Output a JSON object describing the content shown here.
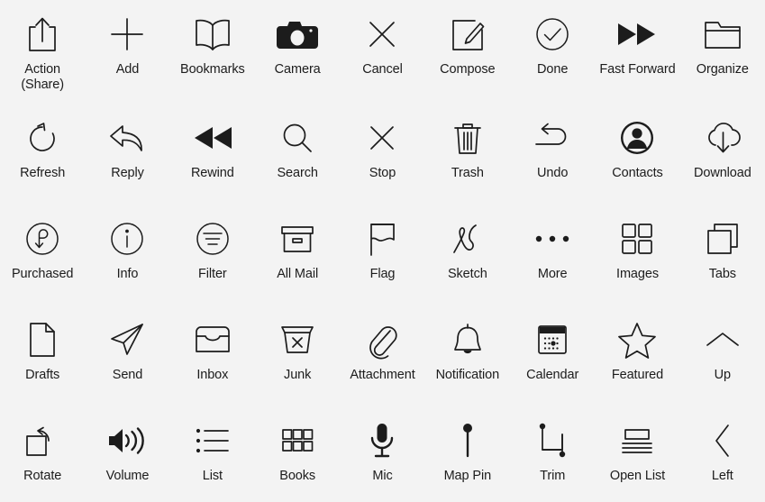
{
  "page": {
    "title": "iOS System Icons Reference Sheet",
    "background_color": "#f3f3f3",
    "icon_color": "#1c1c1c",
    "columns": 9,
    "rows": 5,
    "total_icons": 45
  },
  "icons": [
    {
      "label": "Action\n(Share)",
      "name": "action-share-icon"
    },
    {
      "label": "Add",
      "name": "add-icon"
    },
    {
      "label": "Bookmarks",
      "name": "bookmarks-icon"
    },
    {
      "label": "Camera",
      "name": "camera-icon"
    },
    {
      "label": "Cancel",
      "name": "cancel-icon"
    },
    {
      "label": "Compose",
      "name": "compose-icon"
    },
    {
      "label": "Done",
      "name": "done-icon"
    },
    {
      "label": "Fast Forward",
      "name": "fast-forward-icon"
    },
    {
      "label": "Organize",
      "name": "organize-icon"
    },
    {
      "label": "Refresh",
      "name": "refresh-icon"
    },
    {
      "label": "Reply",
      "name": "reply-icon"
    },
    {
      "label": "Rewind",
      "name": "rewind-icon"
    },
    {
      "label": "Search",
      "name": "search-icon"
    },
    {
      "label": "Stop",
      "name": "stop-icon"
    },
    {
      "label": "Trash",
      "name": "trash-icon"
    },
    {
      "label": "Undo",
      "name": "undo-icon"
    },
    {
      "label": "Contacts",
      "name": "contacts-icon"
    },
    {
      "label": "Download",
      "name": "download-icon"
    },
    {
      "label": "Purchased",
      "name": "purchased-icon"
    },
    {
      "label": "Info",
      "name": "info-icon"
    },
    {
      "label": "Filter",
      "name": "filter-icon"
    },
    {
      "label": "All Mail",
      "name": "all-mail-icon"
    },
    {
      "label": "Flag",
      "name": "flag-icon"
    },
    {
      "label": "Sketch",
      "name": "sketch-icon"
    },
    {
      "label": "More",
      "name": "more-icon"
    },
    {
      "label": "Images",
      "name": "images-icon"
    },
    {
      "label": "Tabs",
      "name": "tabs-icon"
    },
    {
      "label": "Drafts",
      "name": "drafts-icon"
    },
    {
      "label": "Send",
      "name": "send-icon"
    },
    {
      "label": "Inbox",
      "name": "inbox-icon"
    },
    {
      "label": "Junk",
      "name": "junk-icon"
    },
    {
      "label": "Attachment",
      "name": "attachment-icon"
    },
    {
      "label": "Notification",
      "name": "notification-icon"
    },
    {
      "label": "Calendar",
      "name": "calendar-icon"
    },
    {
      "label": "Featured",
      "name": "featured-icon"
    },
    {
      "label": "Up",
      "name": "up-icon"
    },
    {
      "label": "Rotate",
      "name": "rotate-icon"
    },
    {
      "label": "Volume",
      "name": "volume-icon"
    },
    {
      "label": "List",
      "name": "list-icon"
    },
    {
      "label": "Books",
      "name": "books-icon"
    },
    {
      "label": "Mic",
      "name": "mic-icon"
    },
    {
      "label": "Map Pin",
      "name": "map-pin-icon"
    },
    {
      "label": "Trim",
      "name": "trim-icon"
    },
    {
      "label": "Open List",
      "name": "open-list-icon"
    },
    {
      "label": "Left",
      "name": "left-icon"
    }
  ]
}
